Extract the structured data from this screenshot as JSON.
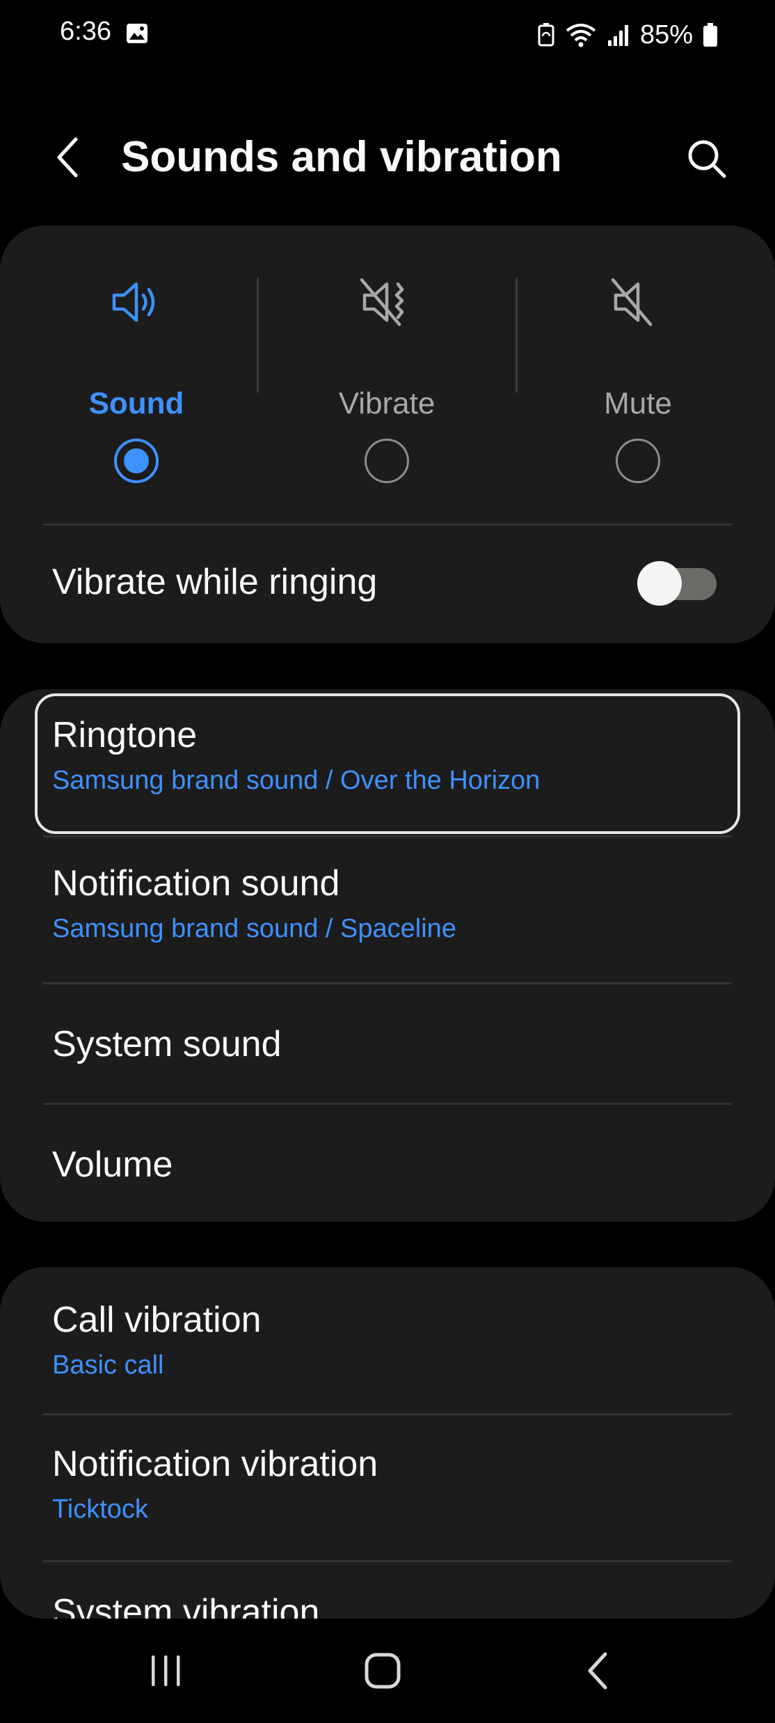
{
  "status_bar": {
    "time": "6:36",
    "battery": "85%",
    "icons": [
      "gallery-icon",
      "battery-saver-icon",
      "wifi-icon",
      "signal-icon",
      "battery-icon"
    ]
  },
  "header": {
    "title": "Sounds and vibration",
    "back_icon": "back-arrow-icon",
    "search_icon": "search-icon"
  },
  "sound_mode": {
    "options": [
      {
        "label": "Sound",
        "icon": "speaker-on-icon",
        "selected": true
      },
      {
        "label": "Vibrate",
        "icon": "vibrate-icon",
        "selected": false
      },
      {
        "label": "Mute",
        "icon": "speaker-mute-icon",
        "selected": false
      }
    ],
    "vibrate_while_ringing": {
      "label": "Vibrate while ringing",
      "enabled": false
    }
  },
  "sound_settings": [
    {
      "title": "Ringtone",
      "subtitle": "Samsung brand sound / Over the Horizon",
      "focused": true
    },
    {
      "title": "Notification sound",
      "subtitle": "Samsung brand sound / Spaceline"
    },
    {
      "title": "System sound"
    },
    {
      "title": "Volume"
    }
  ],
  "vibration_settings": [
    {
      "title": "Call vibration",
      "subtitle": "Basic call"
    },
    {
      "title": "Notification vibration",
      "subtitle": "Ticktock"
    },
    {
      "title": "System vibration"
    }
  ],
  "nav_bar": {
    "buttons": [
      "recent-apps-icon",
      "home-icon",
      "back-icon"
    ]
  },
  "colors": {
    "accent": "#3e91ff",
    "background": "#000000",
    "card": "#1c1c1c",
    "text": "#fafafa",
    "secondary_text": "#a8a8a8"
  }
}
